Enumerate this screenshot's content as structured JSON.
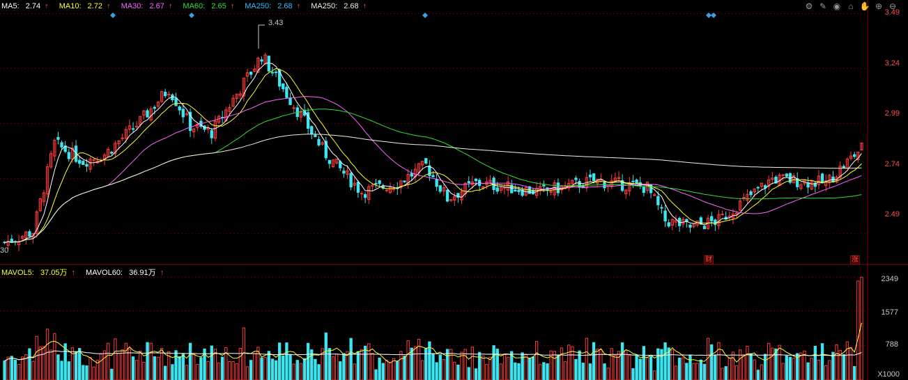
{
  "legend": {
    "ma5": {
      "label": "MA5:",
      "value": "2.74",
      "arrow": "↑",
      "color": "#ffffff"
    },
    "ma10": {
      "label": "MA10:",
      "value": "2.72",
      "arrow": "↑",
      "color": "#ffff33"
    },
    "ma30": {
      "label": "MA30:",
      "value": "2.67",
      "arrow": "↑",
      "color": "#ff66ff"
    },
    "ma60": {
      "label": "MA60:",
      "value": "2.65",
      "arrow": "↑",
      "color": "#33dd33"
    },
    "ma250a": {
      "label": "MA250:",
      "value": "2.68",
      "arrow": "↑",
      "color": "#33bbff"
    },
    "ma250b": {
      "label": "MA250:",
      "value": "2.68",
      "arrow": "↑",
      "color": "#f0f0e0"
    }
  },
  "vol_legend": {
    "mavol5": {
      "label": "MAVOL5:",
      "value": "37.05万",
      "arrow": "↑",
      "color": "#ffff33"
    },
    "mavol60": {
      "label": "MAVOL60:",
      "value": "36.91万",
      "arrow": "↑",
      "color": "#ffffff"
    }
  },
  "toolbar": [
    {
      "icon": "settings-icon",
      "glyph": "⚙"
    },
    {
      "icon": "pen-icon",
      "glyph": "✎"
    },
    {
      "icon": "eye-icon",
      "glyph": "◉"
    },
    {
      "icon": "basket-icon",
      "glyph": "⌂"
    },
    {
      "icon": "hand-icon",
      "glyph": "✋"
    },
    {
      "icon": "zoom-in-icon",
      "glyph": "⊕"
    },
    {
      "icon": "zoom-out-icon",
      "glyph": "⊖"
    }
  ],
  "price_axis": [
    "3.49",
    "3.24",
    "2.99",
    "2.74",
    "2.49"
  ],
  "volume_axis": [
    "2349",
    "1577",
    "788"
  ],
  "volume_unit": "X1000",
  "annotations": {
    "peak_value": "3.43",
    "left_value": "30",
    "flag_cai": "财",
    "flag_zhang": "涨"
  },
  "colors": {
    "up": "#ff3c3c",
    "down": "#3ce6f0",
    "grid": "#5a0000",
    "axis": "#8a0000"
  },
  "chart_data": [
    {
      "type": "candlestick",
      "y_axis_ticks": [
        3.49,
        3.24,
        2.99,
        2.74,
        2.49
      ],
      "ylim": [
        2.35,
        3.52
      ],
      "seed": 7,
      "count": 200,
      "close_path": [
        [
          0,
          2.45
        ],
        [
          8,
          2.5
        ],
        [
          14,
          2.9
        ],
        [
          22,
          2.82
        ],
        [
          28,
          2.85
        ],
        [
          38,
          3.0
        ],
        [
          46,
          3.15
        ],
        [
          52,
          2.98
        ],
        [
          58,
          2.95
        ],
        [
          64,
          3.1
        ],
        [
          72,
          3.3
        ],
        [
          80,
          3.1
        ],
        [
          90,
          2.85
        ],
        [
          100,
          2.68
        ],
        [
          110,
          2.72
        ],
        [
          118,
          2.8
        ],
        [
          124,
          2.65
        ],
        [
          132,
          2.72
        ],
        [
          150,
          2.68
        ],
        [
          165,
          2.73
        ],
        [
          180,
          2.7
        ],
        [
          185,
          2.55
        ],
        [
          192,
          2.52
        ],
        [
          200,
          2.55
        ],
        [
          215,
          2.74
        ],
        [
          230,
          2.72
        ],
        [
          240,
          2.88
        ]
      ],
      "series": [
        {
          "name": "MA5",
          "color": "#ffffff"
        },
        {
          "name": "MA10",
          "color": "#ffff33"
        },
        {
          "name": "MA30",
          "color": "#ff66ff"
        },
        {
          "name": "MA60",
          "color": "#33dd33"
        },
        {
          "name": "MA250",
          "color": "#f0f0e0"
        }
      ]
    },
    {
      "type": "bar",
      "name": "volume",
      "y_axis_ticks": [
        788,
        1577,
        2349
      ],
      "ylim": [
        0,
        2400
      ],
      "series": [
        {
          "name": "MAVOL5",
          "color": "#ffff33"
        },
        {
          "name": "MAVOL60",
          "color": "#ffffff"
        }
      ]
    }
  ]
}
